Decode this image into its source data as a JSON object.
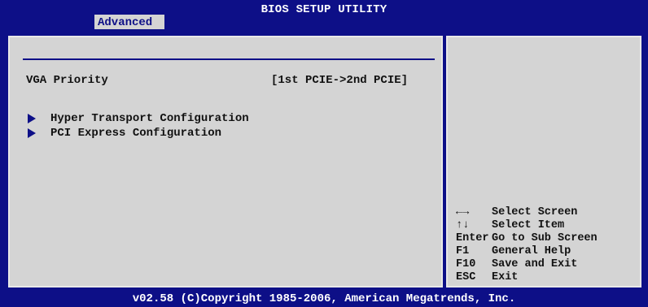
{
  "header": {
    "title": "BIOS SETUP UTILITY",
    "active_tab": "Advanced"
  },
  "main": {
    "setting": {
      "label": "VGA Priority",
      "value": "[1st PCIE->2nd PCIE]"
    },
    "submenus": [
      {
        "label": "Hyper Transport Configuration",
        "icon": "triangle-right-icon"
      },
      {
        "label": "PCI Express Configuration",
        "icon": "triangle-right-icon"
      }
    ]
  },
  "help": {
    "items": [
      {
        "key": "←→",
        "desc": "Select Screen"
      },
      {
        "key": "↑↓",
        "desc": "Select Item"
      },
      {
        "key": "Enter",
        "desc": "Go to Sub Screen"
      },
      {
        "key": "F1",
        "desc": "General Help"
      },
      {
        "key": "F10",
        "desc": "Save and Exit"
      },
      {
        "key": "ESC",
        "desc": "Exit"
      }
    ]
  },
  "footer": {
    "copyright": "v02.58 (C)Copyright 1985-2006, American Megatrends, Inc."
  },
  "colors": {
    "background_blue": "#0d0f87",
    "panel_gray": "#d4d4d4",
    "text_dark": "#111111",
    "text_white": "#ffffff"
  }
}
